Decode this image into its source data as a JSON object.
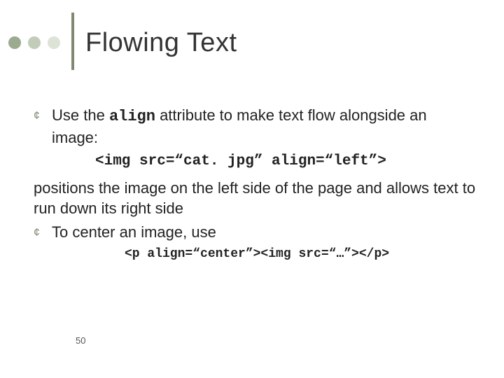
{
  "title": "Flowing Text",
  "bullets": {
    "b1_pre": "Use the ",
    "b1_code": "align",
    "b1_post": " attribute to make text flow alongside an image:",
    "code1": "<img src=“cat. jpg” align=“left”>",
    "plain": "positions the image on the left side of the page and allows text to run down its right side",
    "b2": "To center an image, use",
    "code2": "<p align=“center”><img src=“…”></p>"
  },
  "page_number": "50"
}
